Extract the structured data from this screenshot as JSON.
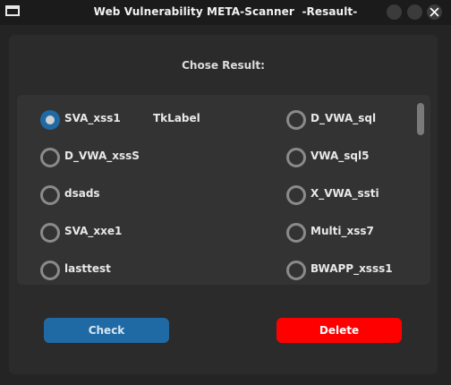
{
  "window": {
    "title": "Web Vulnerability META-Scanner  -Resault-"
  },
  "heading": "Chose Result:",
  "results": [
    {
      "label": "SVA_xss1",
      "selected": true
    },
    {
      "label": "D_VWA_xssS",
      "selected": false
    },
    {
      "label": "dsads",
      "selected": false
    },
    {
      "label": "SVA_xxe1",
      "selected": false
    },
    {
      "label": "lasttest",
      "selected": false
    },
    {
      "label": "D_VWA_sql",
      "selected": false
    },
    {
      "label": "VWA_sql5",
      "selected": false
    },
    {
      "label": "X_VWA_ssti",
      "selected": false
    },
    {
      "label": "Multi_xss7",
      "selected": false
    },
    {
      "label": "BWAPP_xsss1",
      "selected": false
    }
  ],
  "overlay_label": "TkLabel",
  "buttons": {
    "check": "Check",
    "delete": "Delete"
  },
  "colors": {
    "accent": "#1f6aa5",
    "danger": "#ff0000",
    "background": "#242424",
    "frame": "#2b2b2b",
    "list_bg": "#333333"
  }
}
